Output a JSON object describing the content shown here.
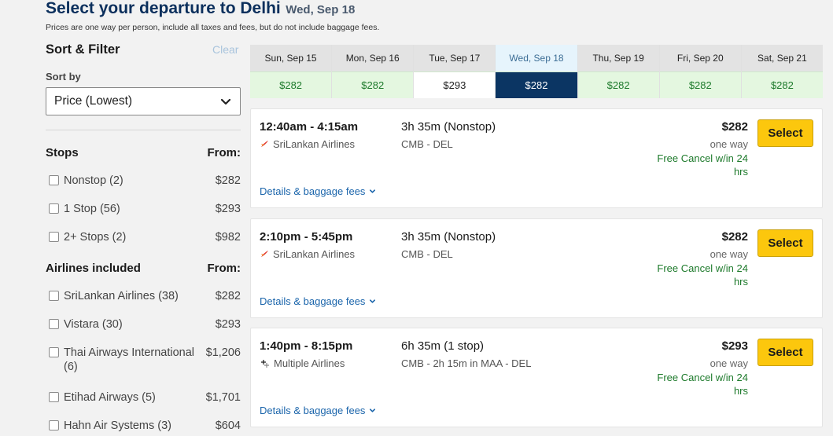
{
  "header": {
    "title": "Select your departure to Delhi",
    "date": "Wed, Sep 18",
    "note": "Prices are one way per person, include all taxes and fees, but do not include baggage fees."
  },
  "sidebar": {
    "title": "Sort & Filter",
    "clear": "Clear",
    "sort_label": "Sort by",
    "sort_value": "Price (Lowest)",
    "stops": {
      "heading": "Stops",
      "from": "From:",
      "items": [
        {
          "label": "Nonstop (2)",
          "price": "$282"
        },
        {
          "label": "1 Stop (56)",
          "price": "$293"
        },
        {
          "label": "2+ Stops (2)",
          "price": "$982"
        }
      ]
    },
    "airlines": {
      "heading": "Airlines included",
      "from": "From:",
      "items": [
        {
          "label": "SriLankan Airlines (38)",
          "price": "$282"
        },
        {
          "label": "Vistara (30)",
          "price": "$293"
        },
        {
          "label": "Thai Airways International (6)",
          "price": "$1,206"
        },
        {
          "label": "Etihad Airways (5)",
          "price": "$1,701"
        },
        {
          "label": "Hahn Air Systems (3)",
          "price": "$604"
        }
      ]
    }
  },
  "dates": [
    {
      "label": "Sun, Sep 15",
      "price": "$282"
    },
    {
      "label": "Mon, Sep 16",
      "price": "$282"
    },
    {
      "label": "Tue, Sep 17",
      "price": "$293"
    },
    {
      "label": "Wed, Sep 18",
      "price": "$282"
    },
    {
      "label": "Thu, Sep 19",
      "price": "$282"
    },
    {
      "label": "Fri, Sep 20",
      "price": "$282"
    },
    {
      "label": "Sat, Sep 21",
      "price": "$282"
    }
  ],
  "flights": [
    {
      "time": "12:40am - 4:15am",
      "airline": "SriLankan Airlines",
      "airline_icon": "srilankan-logo-icon",
      "duration": "3h 35m (Nonstop)",
      "route": "CMB - DEL",
      "price": "$282",
      "price_note": "one way",
      "cancel": "Free Cancel w/in 24 hrs",
      "select": "Select",
      "details": "Details & baggage fees"
    },
    {
      "time": "2:10pm - 5:45pm",
      "airline": "SriLankan Airlines",
      "airline_icon": "srilankan-logo-icon",
      "duration": "3h 35m (Nonstop)",
      "route": "CMB - DEL",
      "price": "$282",
      "price_note": "one way",
      "cancel": "Free Cancel w/in 24 hrs",
      "select": "Select",
      "details": "Details & baggage fees"
    },
    {
      "time": "1:40pm - 8:15pm",
      "airline": "Multiple Airlines",
      "airline_icon": "multiple-airlines-icon",
      "duration": "6h 35m (1 stop)",
      "route": "CMB - 2h 15m in MAA - DEL",
      "price": "$293",
      "price_note": "one way",
      "cancel": "Free Cancel w/in 24 hrs",
      "select": "Select",
      "details": "Details & baggage fees"
    }
  ],
  "colors": {
    "title": "#0b2f5c",
    "selected_date": "#0b3563",
    "price_green": "#1d7a2b",
    "select_button": "#fcc70d",
    "link": "#1b65ab"
  }
}
